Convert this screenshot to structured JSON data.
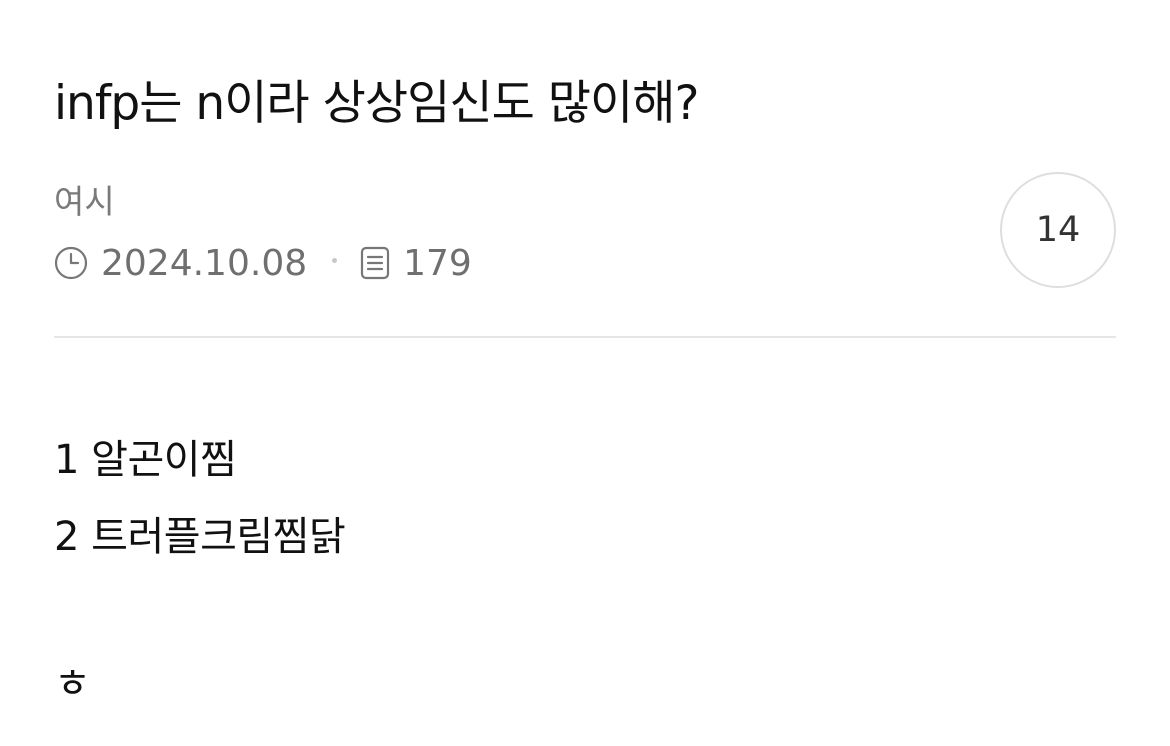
{
  "post": {
    "title": "infp는 n이라 상상임신도 많이해?",
    "author": "여시",
    "date": "2024.10.08",
    "views": "179",
    "comment_count": "14",
    "icons": {
      "date": "clock-icon",
      "views": "document-icon"
    },
    "body_lines": [
      "1 알곤이찜",
      "2 트러플크림찜닭",
      "ㅎ"
    ]
  },
  "colors": {
    "title": "#111111",
    "meta_text": "#6f6f6f",
    "author_text": "#7a7a7a",
    "divider": "#e6e6e6",
    "comment_circle_border": "#dedede"
  }
}
